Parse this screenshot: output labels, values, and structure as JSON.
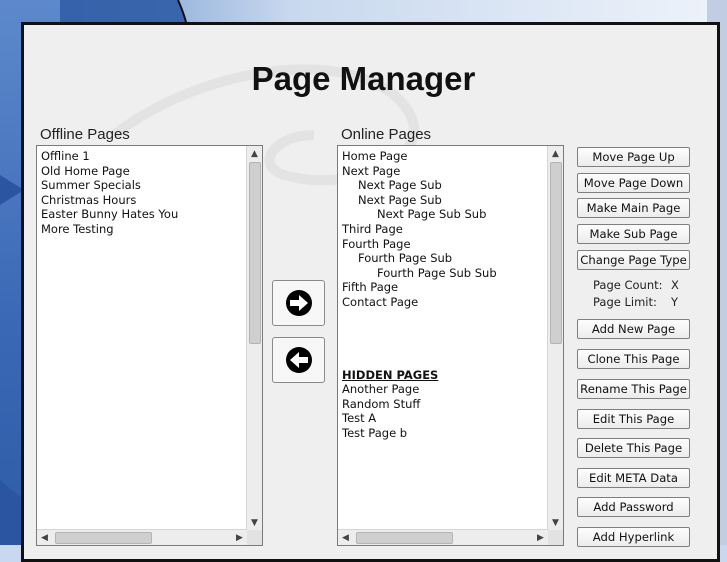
{
  "title": "Page Manager",
  "offline": {
    "label": "Offline Pages",
    "items": [
      {
        "text": "Offline 1"
      },
      {
        "text": "Old Home Page"
      },
      {
        "text": "Summer Specials"
      },
      {
        "text": "Christmas Hours"
      },
      {
        "text": "Easter Bunny Hates You"
      },
      {
        "text": "More Testing"
      }
    ]
  },
  "online": {
    "label": "Online Pages",
    "items": [
      {
        "text": "Home Page",
        "level": 0
      },
      {
        "text": "Next Page",
        "level": 0
      },
      {
        "text": "Next Page Sub",
        "level": 1
      },
      {
        "text": "Next Page Sub",
        "level": 1
      },
      {
        "text": "Next Page Sub Sub",
        "level": 2
      },
      {
        "text": "Third Page",
        "level": 0
      },
      {
        "text": "Fourth Page",
        "level": 0
      },
      {
        "text": "Fourth Page Sub",
        "level": 1
      },
      {
        "text": "Fourth Page Sub Sub",
        "level": 2
      },
      {
        "text": "Fifth Page",
        "level": 0
      },
      {
        "text": "Contact Page",
        "level": 0
      }
    ],
    "hidden_header": "HIDDEN PAGES",
    "hidden_items": [
      {
        "text": "Another Page"
      },
      {
        "text": "Random Stuff"
      },
      {
        "text": "Test A"
      },
      {
        "text": "Test Page b"
      }
    ]
  },
  "move_right_icon": "arrow-right-icon",
  "move_left_icon": "arrow-left-icon",
  "buttons": {
    "move_up": "Move Page Up",
    "move_down": "Move Page Down",
    "make_main": "Make Main Page",
    "make_sub": "Make Sub Page",
    "change_type": "Change Page Type",
    "add_new": "Add New Page",
    "clone": "Clone This Page",
    "rename": "Rename This Page",
    "edit": "Edit This Page",
    "delete": "Delete This Page",
    "edit_meta": "Edit META Data",
    "add_password": "Add Password",
    "add_hyperlink": "Add Hyperlink"
  },
  "stats": {
    "page_count_label": "Page Count:",
    "page_count_value": "X",
    "page_limit_label": "Page Limit:",
    "page_limit_value": "Y"
  }
}
